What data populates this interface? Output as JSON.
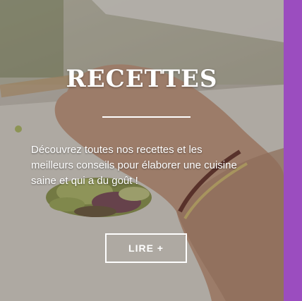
{
  "card": {
    "title": "RECETTES",
    "description": "Découvrez toutes nos recettes et les meilleurs  conseils pour élaborer une cuisine saine et qui a du goût !",
    "button_label": "LIRE +"
  },
  "colors": {
    "accent_bar": "#9b4dbf",
    "text": "#ffffff",
    "pistachio": "#a6b86b"
  },
  "image": {
    "subject": "hand chopping pistachios on a cutting board"
  }
}
